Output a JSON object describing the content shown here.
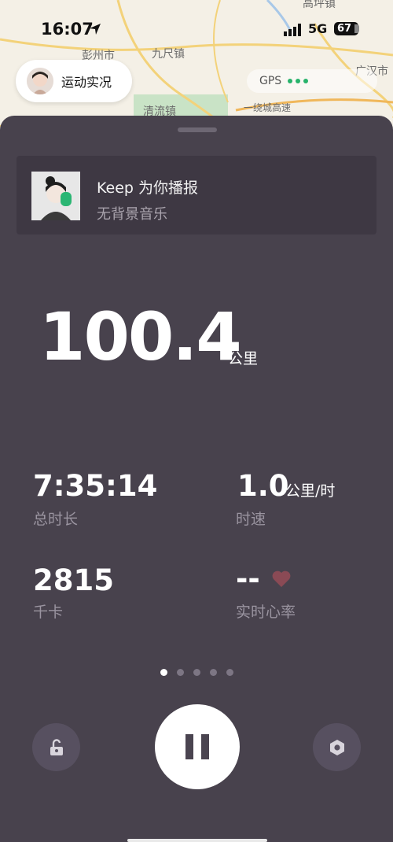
{
  "status_bar": {
    "time": "16:07",
    "network": "5G",
    "battery": "67"
  },
  "map": {
    "labels": [
      "彭州市",
      "九尺镇",
      "清流镇",
      "高坪镇",
      "广汉市",
      "一绕城高速"
    ],
    "colors": {
      "background": "#f4f0e6",
      "road": "#f3d27a",
      "water": "#a8c8e8",
      "park": "#c9e3c6"
    }
  },
  "activity_chip": {
    "label": "运动实况"
  },
  "gps": {
    "label": "GPS",
    "status_color": "#27b36b"
  },
  "broadcast": {
    "title": "Keep 为你播报",
    "subtitle": "无背景音乐"
  },
  "distance": {
    "value": "100.4",
    "unit": "公里"
  },
  "stats": {
    "duration": {
      "value": "7:35:14",
      "label": "总时长"
    },
    "speed": {
      "value": "1.0",
      "unit": "公里/时",
      "label": "时速"
    },
    "calories": {
      "value": "2815",
      "label": "千卡"
    },
    "heart_rate": {
      "value": "--",
      "label": "实时心率",
      "icon": "heart-icon",
      "color": "#8a4a55"
    }
  },
  "pager": {
    "count": 5,
    "active_index": 0
  },
  "controls": {
    "left_icon": "unlock-icon",
    "center_icon": "pause-icon",
    "right_icon": "hexagon-settings-icon"
  },
  "colors": {
    "sheet": "#48424d",
    "card": "#3e3843",
    "label": "#9a94a0"
  }
}
